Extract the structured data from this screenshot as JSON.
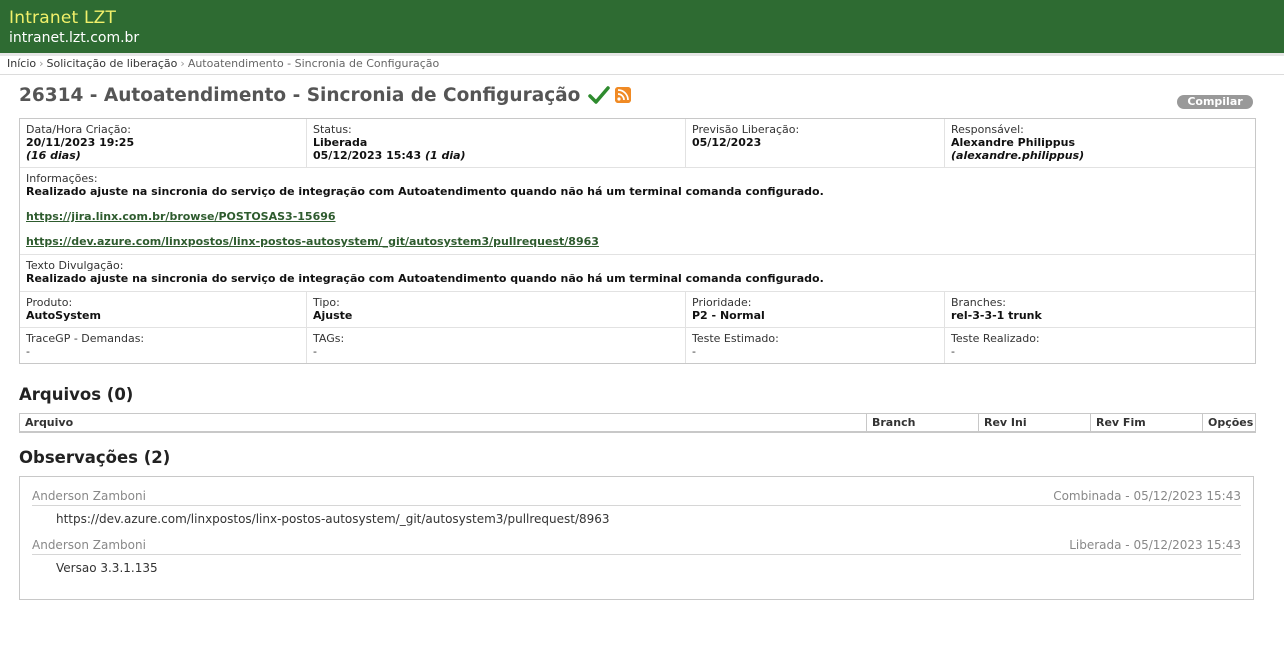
{
  "header": {
    "title": "Intranet LZT",
    "host": "intranet.lzt.com.br"
  },
  "breadcrumb": [
    "Início",
    "Solicitação de liberação",
    "Autoatendimento - Sincronia de Configuração"
  ],
  "page": {
    "title": "26314 - Autoatendimento - Sincronia de Configuração",
    "compile_label": "Compilar"
  },
  "info": {
    "criacao_label": "Data/Hora Criação:",
    "criacao_value": "20/11/2023 19:25",
    "criacao_sub": "(16 dias)",
    "status_label": "Status:",
    "status_value": "Liberada",
    "status_date": "05/12/2023 15:43",
    "status_sub": "(1 dia)",
    "previsao_label": "Previsão Liberação:",
    "previsao_value": "05/12/2023",
    "responsavel_label": "Responsável:",
    "responsavel_value": "Alexandre Philippus",
    "responsavel_sub": "(alexandre.philippus)",
    "informacoes_label": "Informações:",
    "informacoes_text": "Realizado ajuste na sincronia do serviço de integração com Autoatendimento quando não há um terminal comanda configurado.",
    "link1": "https://jira.linx.com.br/browse/POSTOSAS3-15696",
    "link2": "https://dev.azure.com/linxpostos/linx-postos-autosystem/_git/autosystem3/pullrequest/8963",
    "divulgacao_label": "Texto Divulgação:",
    "divulgacao_text": "Realizado ajuste na sincronia do serviço de integração com Autoatendimento quando não há um terminal comanda configurado.",
    "produto_label": "Produto:",
    "produto_value": "AutoSystem",
    "tipo_label": "Tipo:",
    "tipo_value": "Ajuste",
    "prioridade_label": "Prioridade:",
    "prioridade_value": "P2 - Normal",
    "branches_label": "Branches:",
    "branches_value": "rel-3-3-1 trunk",
    "tracegp_label": "TraceGP - Demandas:",
    "tracegp_value": "-",
    "tags_label": "TAGs:",
    "tags_value": "-",
    "teste_est_label": "Teste Estimado:",
    "teste_est_value": "-",
    "teste_real_label": "Teste Realizado:",
    "teste_real_value": "-"
  },
  "arquivos": {
    "title": "Arquivos (0)",
    "columns": [
      "Arquivo",
      "Branch",
      "Rev Ini",
      "Rev Fim",
      "Opções"
    ]
  },
  "observacoes": {
    "title": "Observações (2)",
    "items": [
      {
        "author": "Anderson Zamboni",
        "meta": "Combinada - 05/12/2023 15:43",
        "text": "https://dev.azure.com/linxpostos/linx-postos-autosystem/_git/autosystem3/pullrequest/8963"
      },
      {
        "author": "Anderson Zamboni",
        "meta": "Liberada - 05/12/2023 15:43",
        "text": "Versao 3.3.1.135"
      }
    ]
  },
  "colors": {
    "header_bg": "#2e6b32",
    "title_yellow": "#f0f06a",
    "check_green": "#2e8b2e",
    "rss_orange": "#f08a24"
  }
}
